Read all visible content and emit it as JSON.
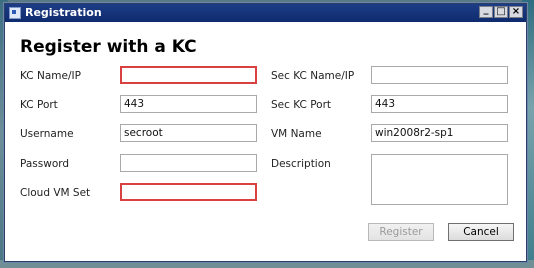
{
  "window": {
    "title": "Registration",
    "controls": {
      "minimize": "_",
      "maximize": "□",
      "close": "×"
    }
  },
  "heading": "Register with a KC",
  "left": {
    "kc_name_ip": {
      "label": "KC Name/IP",
      "value": ""
    },
    "kc_port": {
      "label": "KC Port",
      "value": "443"
    },
    "username": {
      "label": "Username",
      "value": "secroot"
    },
    "password": {
      "label": "Password",
      "value": ""
    },
    "cloud_vm_set": {
      "label": "Cloud VM Set",
      "value": ""
    }
  },
  "right": {
    "sec_kc_name_ip": {
      "label": "Sec KC Name/IP",
      "value": ""
    },
    "sec_kc_port": {
      "label": "Sec KC Port",
      "value": "443"
    },
    "vm_name": {
      "label": "VM Name",
      "value": "win2008r2-sp1"
    },
    "description": {
      "label": "Description",
      "value": ""
    }
  },
  "buttons": {
    "register": "Register",
    "cancel": "Cancel"
  },
  "colors": {
    "titlebar": "#1d3d86",
    "error_border": "#d94141"
  }
}
